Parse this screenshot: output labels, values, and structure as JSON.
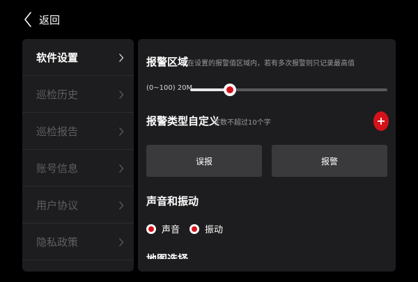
{
  "header": {
    "back_label": "返回",
    "back_icon": "chevron-left-icon"
  },
  "sidebar": {
    "items": [
      {
        "label": "软件设置",
        "active": true
      },
      {
        "label": "巡检历史",
        "active": false
      },
      {
        "label": "巡检报告",
        "active": false
      },
      {
        "label": "账号信息",
        "active": false
      },
      {
        "label": "用户协议",
        "active": false
      },
      {
        "label": "隐私政策",
        "active": false
      }
    ],
    "chevron_icon": "chevron-right-icon"
  },
  "alarm_area": {
    "title": "报警区域",
    "hint": "在设置的报警值区域内，若有多次报警则只记录最高值",
    "range_label": "(0~100) 20M",
    "slider_value": 20,
    "slider_min": 0,
    "slider_max": 100
  },
  "alarm_type": {
    "title": "报警类型自定义",
    "hint": "字数不超过10个字",
    "add_icon": "plus-icon",
    "buttons": [
      "误报",
      "报警"
    ]
  },
  "sound": {
    "title": "声音和振动",
    "options": [
      {
        "label": "声音",
        "checked": true
      },
      {
        "label": "振动",
        "checked": true
      }
    ]
  },
  "partial_section": {
    "title": "地图选择"
  },
  "colors": {
    "background": "#000000",
    "panel": "#1d1d1f",
    "accent": "#d5121b",
    "button": "#3a3a3c",
    "muted_text": "#5f5f63"
  }
}
